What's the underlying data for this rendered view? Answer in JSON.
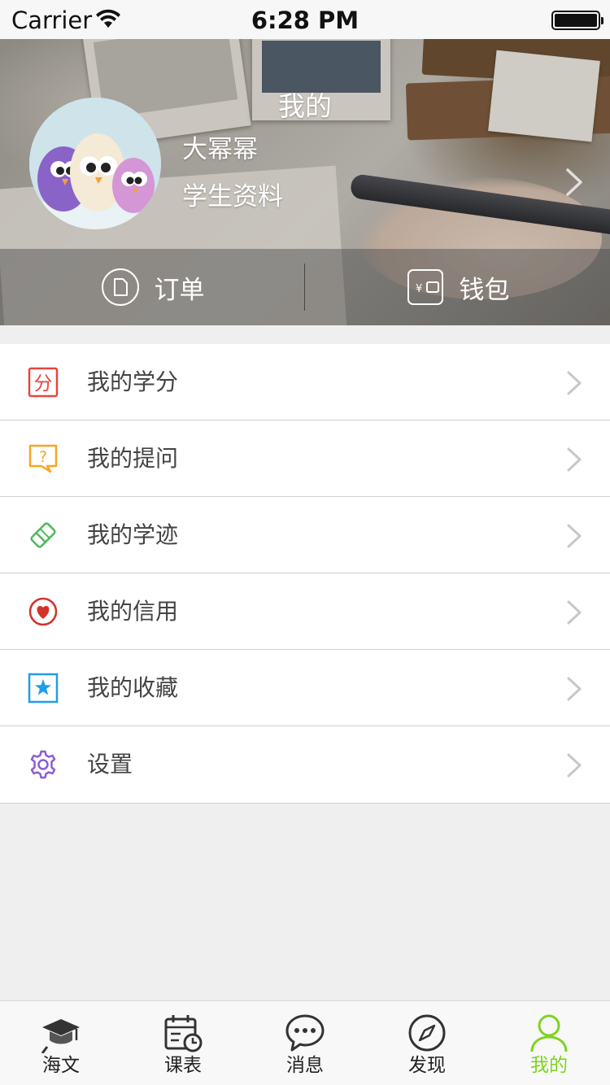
{
  "status_bar": {
    "carrier": "Carrier",
    "time": "6:28 PM"
  },
  "header": {
    "title": "我的",
    "user_name": "大幂幂",
    "profile_link": "学生资料",
    "actions": [
      {
        "label": "订单",
        "icon": "document-icon"
      },
      {
        "label": "钱包",
        "icon": "wallet-icon"
      }
    ]
  },
  "menu": {
    "items": [
      {
        "label": "我的学分",
        "icon": "credit-score-icon",
        "color": "#e8453c"
      },
      {
        "label": "我的提问",
        "icon": "question-bubble-icon",
        "color": "#f5a623"
      },
      {
        "label": "我的学迹",
        "icon": "eraser-icon",
        "color": "#4cbb5b"
      },
      {
        "label": "我的信用",
        "icon": "heart-icon",
        "color": "#d0342c"
      },
      {
        "label": "我的收藏",
        "icon": "star-icon",
        "color": "#1e9ee8"
      },
      {
        "label": "设置",
        "icon": "gear-icon",
        "color": "#8e5bd6"
      }
    ]
  },
  "tabbar": {
    "active_color": "#7ed321",
    "tabs": [
      {
        "label": "海文",
        "icon": "graduation-cap-icon",
        "active": false
      },
      {
        "label": "课表",
        "icon": "calendar-clock-icon",
        "active": false
      },
      {
        "label": "消息",
        "icon": "chat-bubble-icon",
        "active": false
      },
      {
        "label": "发现",
        "icon": "compass-icon",
        "active": false
      },
      {
        "label": "我的",
        "icon": "person-icon",
        "active": true
      }
    ]
  },
  "avatar_icon_text": "分"
}
